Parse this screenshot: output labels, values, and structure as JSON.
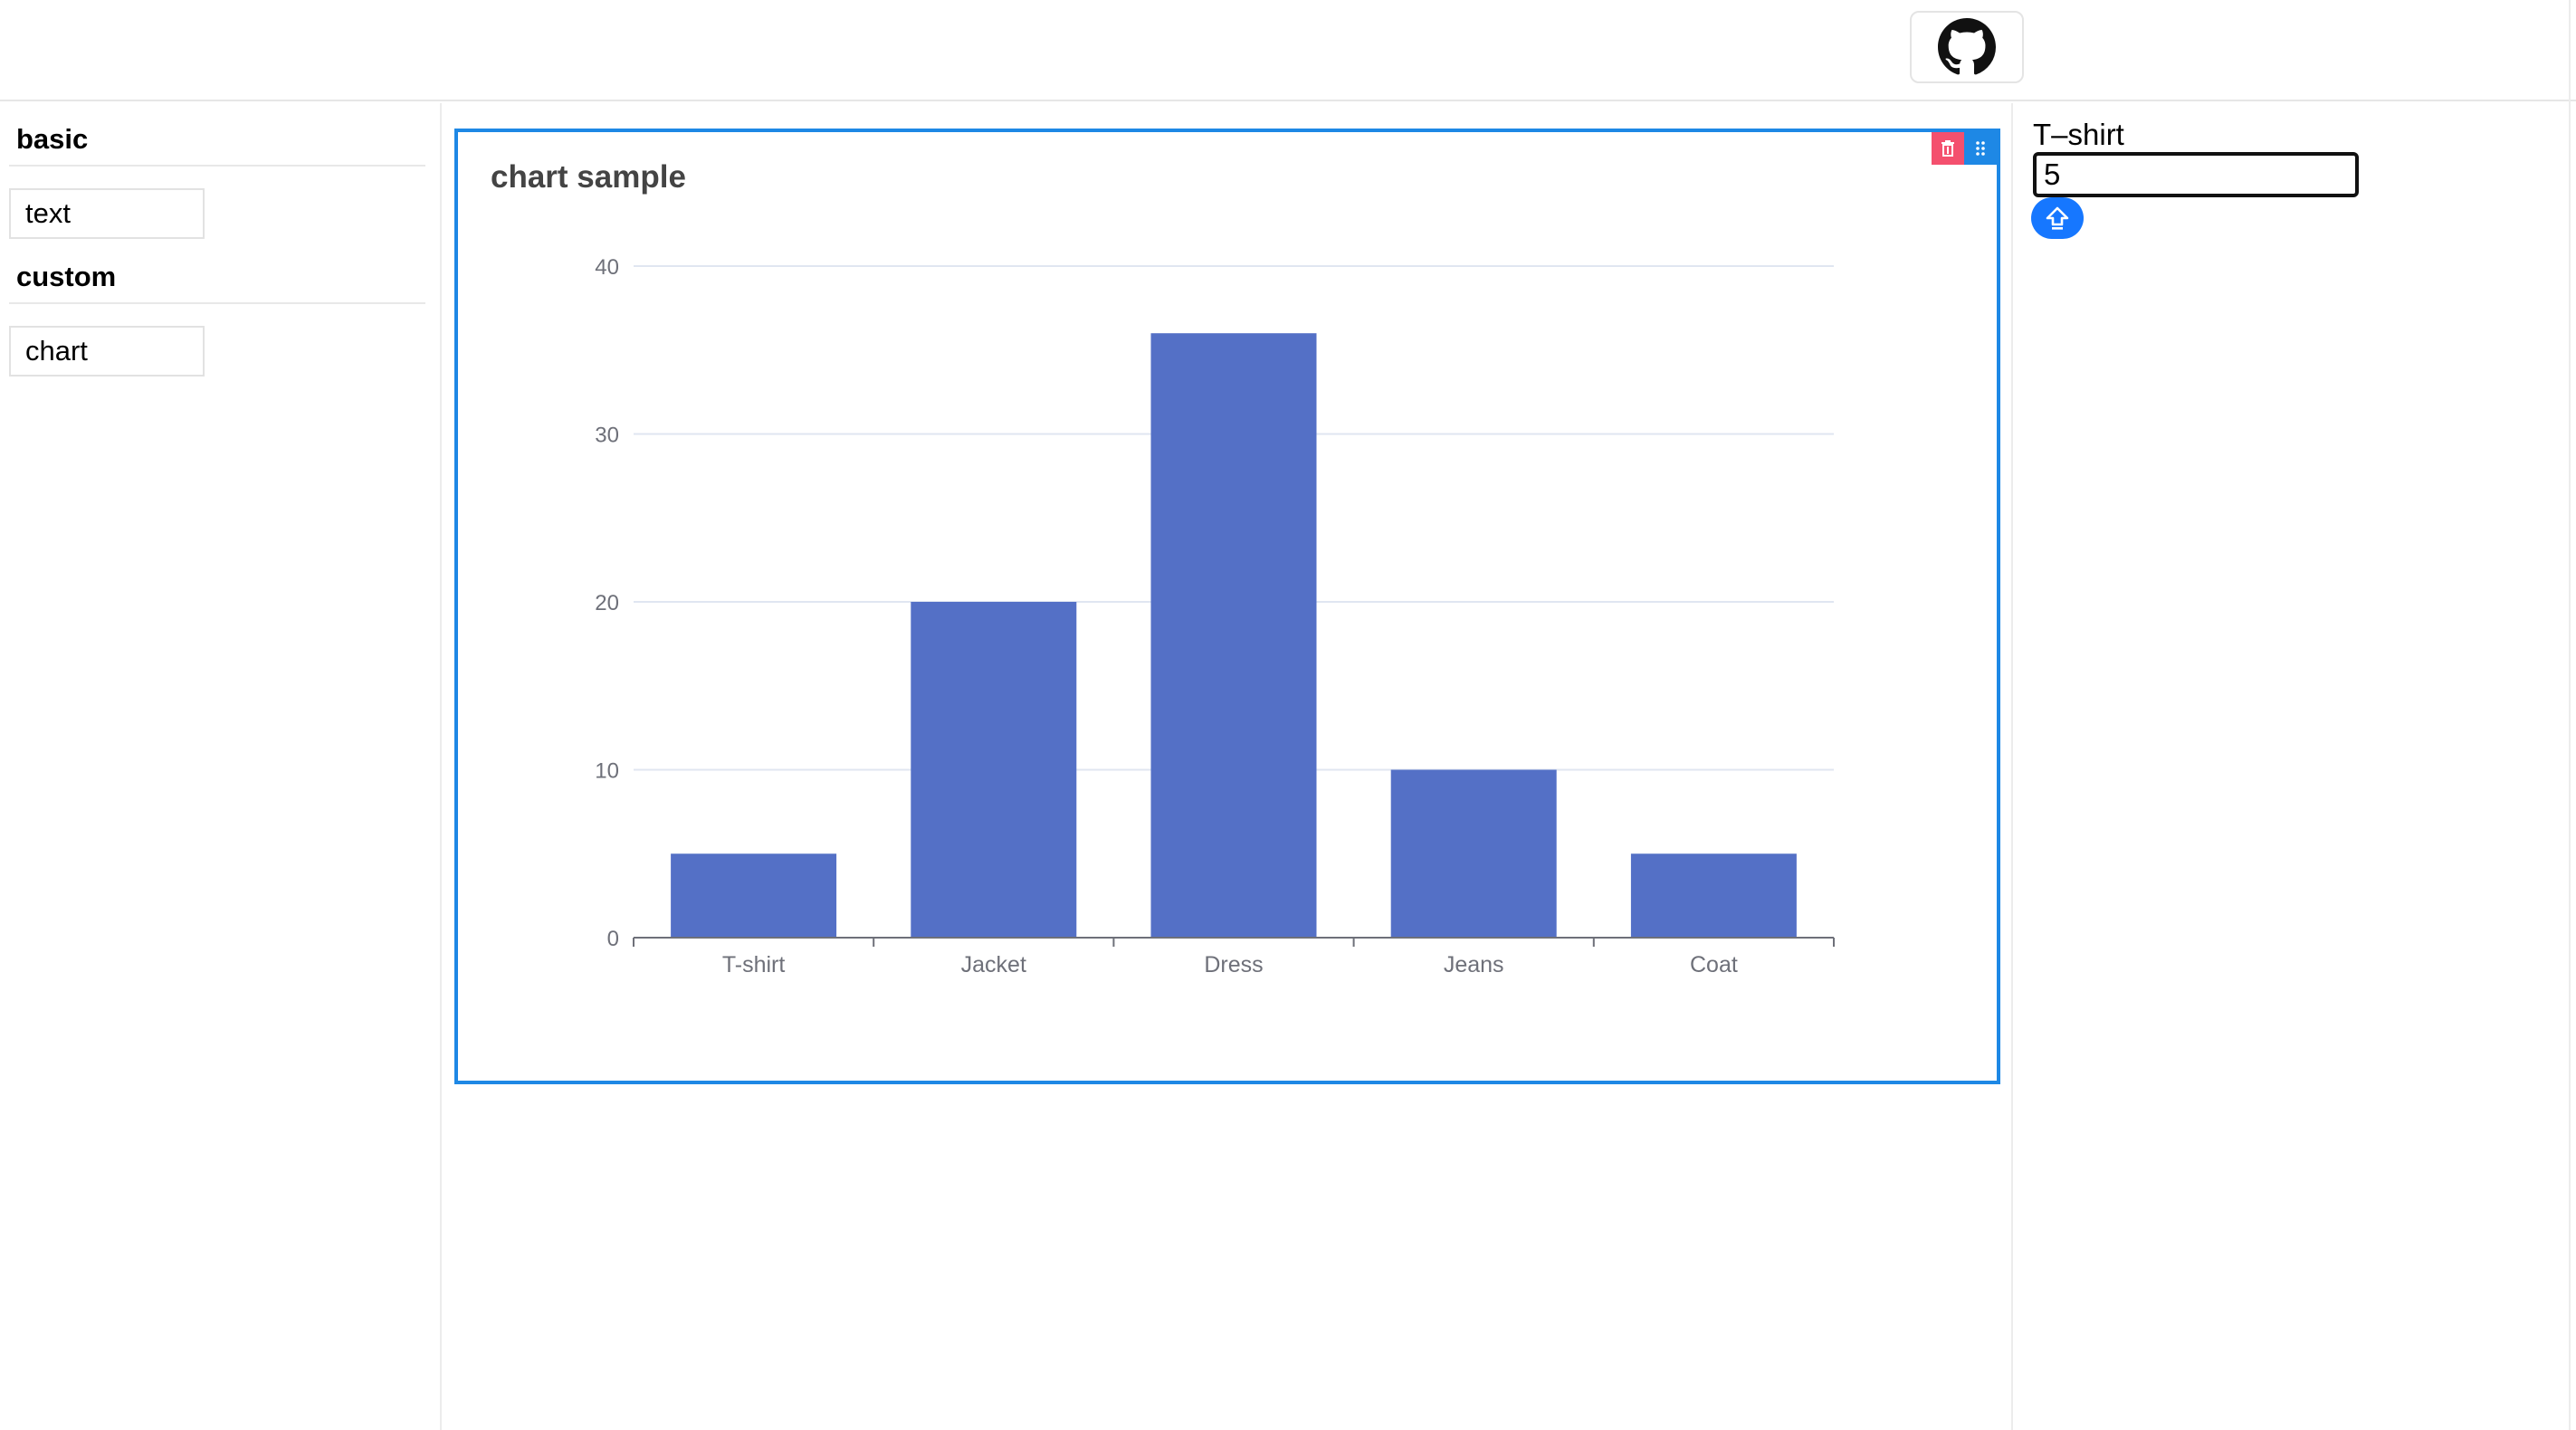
{
  "header": {
    "github_icon": "github-icon"
  },
  "sidebar": {
    "sections": [
      {
        "title": "basic",
        "items": [
          "text"
        ]
      },
      {
        "title": "custom",
        "items": [
          "chart"
        ]
      }
    ]
  },
  "canvas": {
    "card": {
      "delete_icon": "trash-icon",
      "drag_icon": "drag-handle-icon",
      "border_color": "#1e88e5",
      "delete_color": "#f4506e"
    }
  },
  "chart_data": {
    "type": "bar",
    "title": "chart sample",
    "categories": [
      "T-shirt",
      "Jacket",
      "Dress",
      "Jeans",
      "Coat"
    ],
    "values": [
      5,
      20,
      36,
      10,
      5
    ],
    "ylim": [
      0,
      40
    ],
    "yticks": [
      0,
      10,
      20,
      30,
      40
    ],
    "grid": true,
    "bar_color": "#5470c6"
  },
  "properties": {
    "label": "T–shirt",
    "value": "5",
    "apply_icon": "upload-icon",
    "accent": "#1677ff"
  }
}
